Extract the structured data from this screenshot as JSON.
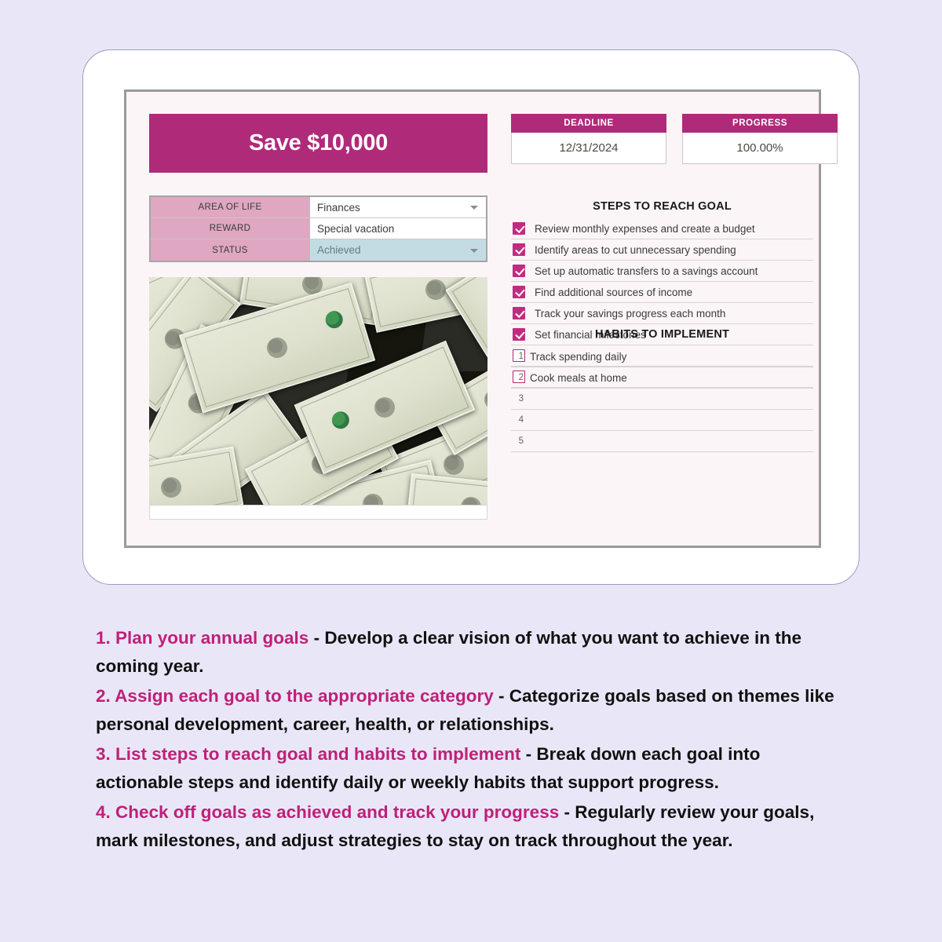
{
  "colors": {
    "page_background": "#e9e7f7",
    "accent_magenta": "#b02a7a",
    "accent_magenta_bright": "#bf2d81",
    "label_pink": "#dfa7c1",
    "status_blue": "#c3dce3",
    "sheet_background": "#fcf5f8"
  },
  "goal": {
    "title": "Save $10,000"
  },
  "meta": {
    "rows": [
      {
        "label": "AREA OF LIFE",
        "value": "Finances",
        "has_dropdown": true,
        "highlight": false
      },
      {
        "label": "REWARD",
        "value": "Special vacation",
        "has_dropdown": false,
        "highlight": false
      },
      {
        "label": "STATUS",
        "value": "Achieved",
        "has_dropdown": true,
        "highlight": true
      }
    ]
  },
  "kpis": [
    {
      "id": "deadline",
      "label": "DEADLINE",
      "value": "12/31/2024"
    },
    {
      "id": "progress",
      "label": "PROGRESS",
      "value": "100.00%"
    }
  ],
  "steps": {
    "title": "STEPS TO REACH GOAL",
    "items": [
      {
        "checked": true,
        "text": "Review monthly expenses and create a budget"
      },
      {
        "checked": true,
        "text": "Identify areas to cut unnecessary spending"
      },
      {
        "checked": true,
        "text": "Set up automatic transfers to a savings account"
      },
      {
        "checked": true,
        "text": "Find additional sources of income"
      },
      {
        "checked": true,
        "text": "Track your savings progress each month"
      },
      {
        "checked": true,
        "text": "Set financial milestones"
      },
      {
        "checked": false,
        "text": ""
      },
      {
        "checked": false,
        "text": ""
      }
    ]
  },
  "habits": {
    "title": "HABITS TO IMPLEMENT",
    "items": [
      {
        "num": "1",
        "text": "Track spending daily"
      },
      {
        "num": "2",
        "text": "Cook meals at home"
      },
      {
        "num": "3",
        "text": ""
      },
      {
        "num": "4",
        "text": ""
      },
      {
        "num": "5",
        "text": ""
      }
    ]
  },
  "photo": {
    "alt": "photograph of scattered one dollar bills"
  },
  "instructions": [
    {
      "lead": "1. Plan your annual goals",
      "body": " - Develop a clear vision of what you want to achieve in the coming year."
    },
    {
      "lead": "2. Assign each goal to the appropriate category",
      "body": " - Categorize goals based on themes like personal development, career, health, or relationships."
    },
    {
      "lead": "3. List steps to reach goal and habits to implement",
      "body": " - Break down each goal into actionable steps and identify daily or weekly habits that support progress."
    },
    {
      "lead": "4. Check off goals as achieved and track your progress",
      "body": " - Regularly review your goals, mark milestones, and adjust strategies to stay on track throughout the year."
    }
  ]
}
